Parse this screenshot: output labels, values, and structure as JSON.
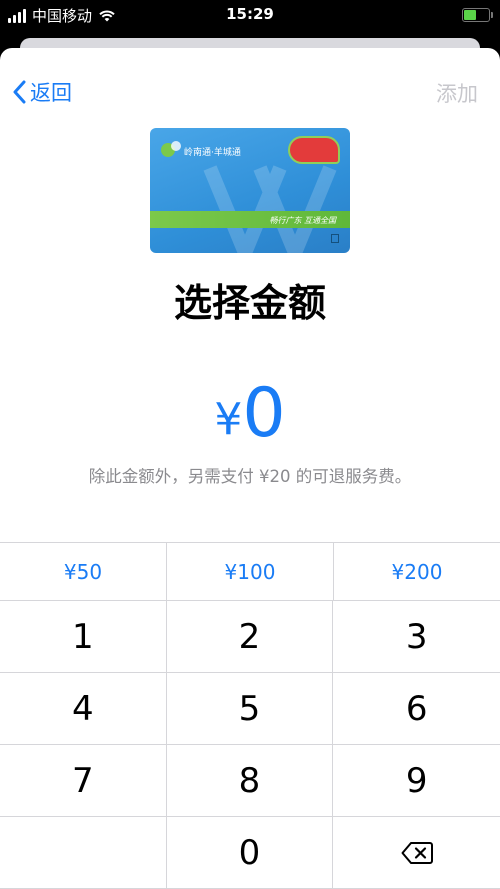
{
  "status_bar": {
    "carrier": "中国移动",
    "time": "15:29"
  },
  "nav": {
    "back_label": "返回",
    "add_label": "添加"
  },
  "card": {
    "brand_text": "岭南通·羊城通",
    "stripe_text": "畅行广东 互通全国"
  },
  "title": "选择金额",
  "amount": {
    "currency": "¥",
    "value": "0"
  },
  "note": "除此金额外，另需支付 ¥20 的可退服务费。",
  "presets": [
    "¥50",
    "¥100",
    "¥200"
  ],
  "keys": [
    "1",
    "2",
    "3",
    "4",
    "5",
    "6",
    "7",
    "8",
    "9",
    "",
    "0"
  ],
  "colors": {
    "accent": "#1a7cf5",
    "disabled": "#c7c7cc",
    "muted": "#8a8a8e"
  }
}
